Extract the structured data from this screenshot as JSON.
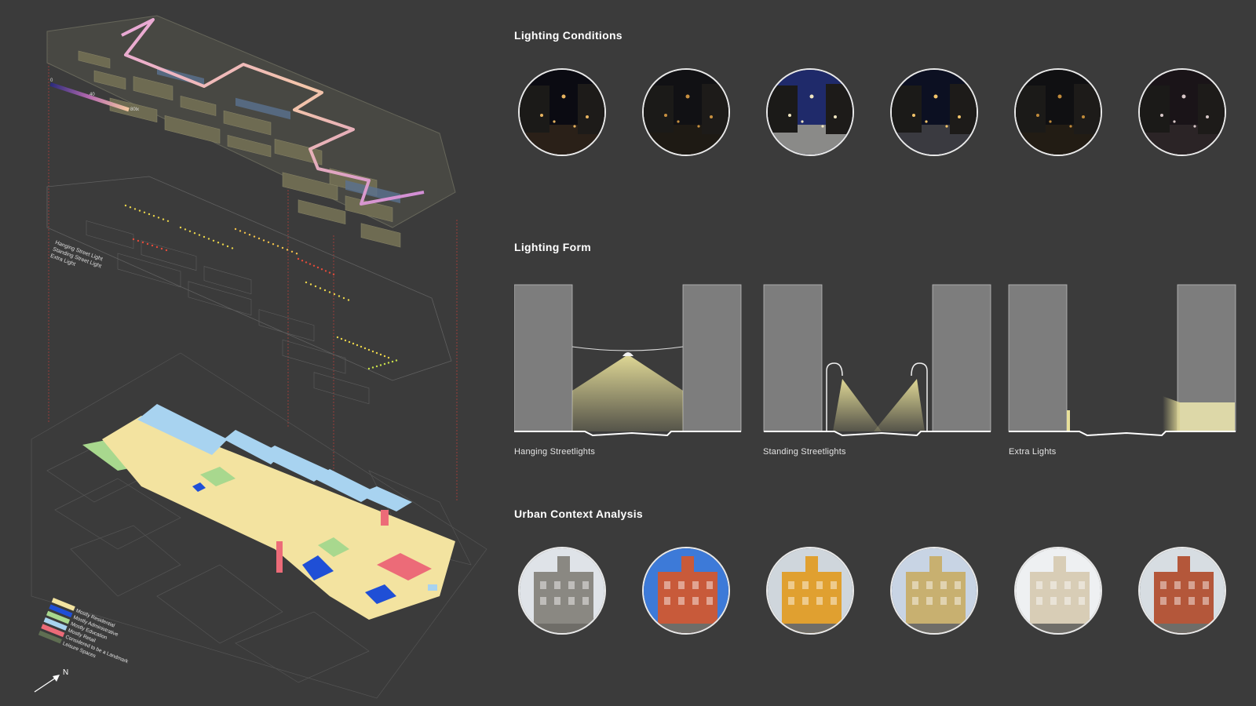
{
  "titles": {
    "lighting_conditions": "Lighting Conditions",
    "lighting_form": "Lighting Form",
    "urban_context": "Urban Context Analysis"
  },
  "gradient_legend": {
    "min": "0",
    "mid": "40",
    "max": "80lx"
  },
  "light_legend": [
    "Hanging Street Light",
    "Standing Street Light",
    "Extra Light"
  ],
  "use_legend": [
    {
      "label": "Mostly Residential",
      "color": "#f3e3a0"
    },
    {
      "label": "Mostly Administrative",
      "color": "#1f4fd6"
    },
    {
      "label": "Mostly Education",
      "color": "#a8d88e"
    },
    {
      "label": "Mostly Retail",
      "color": "#a8d3f0"
    },
    {
      "label": "Considered to be a Landmark",
      "color": "#ec6b78"
    },
    {
      "label": "Leisure Spaces",
      "color": "#5f6e52"
    }
  ],
  "north_label": "N",
  "lighting_form_labels": [
    "Hanging Streetlights",
    "Standing Streetlights",
    "Extra Lights"
  ],
  "night_photos": [
    {
      "name": "night-photo-1",
      "sky": "#0b0b12",
      "ground": "#2a2018",
      "lights": "#e8b460"
    },
    {
      "name": "night-photo-2",
      "sky": "#111114",
      "ground": "#1e1a14",
      "lights": "#c89040"
    },
    {
      "name": "night-photo-3",
      "sky": "#1f2a6a",
      "ground": "#8a8a88",
      "lights": "#f0e6c0"
    },
    {
      "name": "night-photo-4",
      "sky": "#0c1022",
      "ground": "#3a3a40",
      "lights": "#f3c46a"
    },
    {
      "name": "night-photo-5",
      "sky": "#101012",
      "ground": "#221c14",
      "lights": "#c08a3a"
    },
    {
      "name": "night-photo-6",
      "sky": "#1a1418",
      "ground": "#2b2426",
      "lights": "#d8c8c8"
    }
  ],
  "context_photos": [
    {
      "name": "context-photo-tower",
      "sky": "#dfe3e8",
      "building": "#8a8882"
    },
    {
      "name": "context-photo-red-building",
      "sky": "#3d7ad8",
      "building": "#c85a3a"
    },
    {
      "name": "context-photo-yellow-church",
      "sky": "#cfd6dc",
      "building": "#e0a030"
    },
    {
      "name": "context-photo-church-tower",
      "sky": "#c8d4e4",
      "building": "#c8b070"
    },
    {
      "name": "context-photo-palace",
      "sky": "#eef0f2",
      "building": "#d8cdb6"
    },
    {
      "name": "context-photo-market-hall",
      "sky": "#d7dde2",
      "building": "#b4573a"
    }
  ]
}
